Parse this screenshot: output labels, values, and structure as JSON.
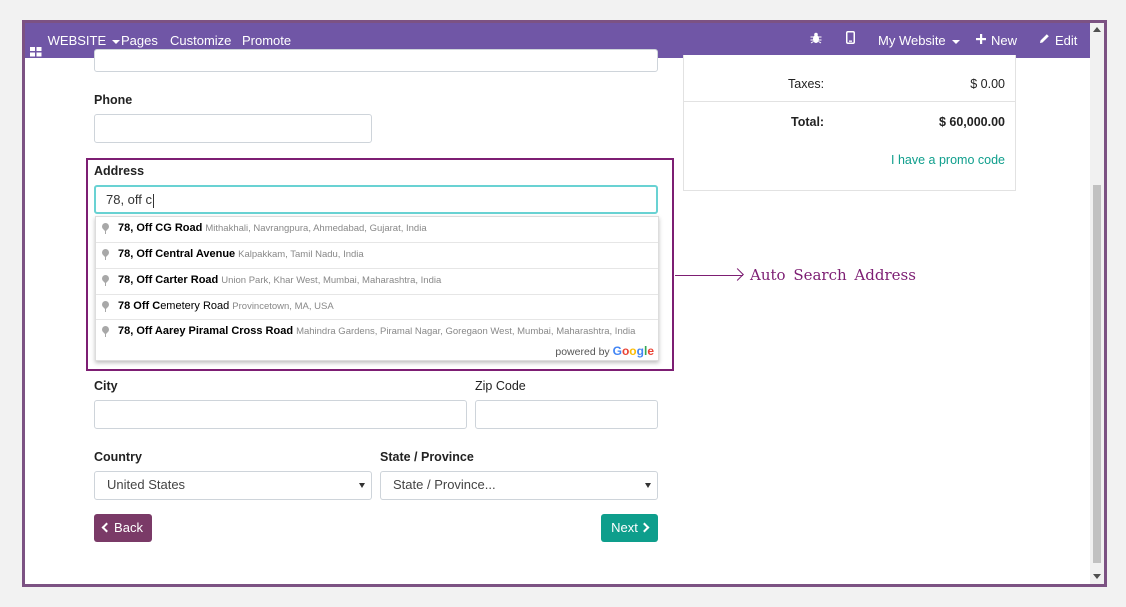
{
  "topbar": {
    "website_label": "WEBSITE",
    "nav": [
      "Pages",
      "Customize",
      "Promote"
    ],
    "my_website_label": "My Website",
    "new_label": "New",
    "edit_label": "Edit"
  },
  "form": {
    "phone_label": "Phone",
    "phone_value": "",
    "address_label": "Address",
    "address_value": "78, off c",
    "city_label": "City",
    "zip_label": "Zip Code",
    "country_label": "Country",
    "country_value": "United States",
    "state_label": "State / Province",
    "state_value": "State / Province..."
  },
  "suggestions": [
    {
      "bold": "78, Off CG Road",
      "normal": "",
      "secondary": "Mithakhali, Navrangpura, Ahmedabad, Gujarat, India"
    },
    {
      "bold": "78, Off Central Avenue",
      "normal": "",
      "secondary": "Kalpakkam, Tamil Nadu, India"
    },
    {
      "bold": "78, Off Carter Road",
      "normal": "",
      "secondary": "Union Park, Khar West, Mumbai, Maharashtra, India"
    },
    {
      "bold": "78 Off C",
      "normal": "emetery Road",
      "secondary": "Provincetown, MA, USA"
    },
    {
      "bold": "78, Off Aarey Piramal Cross Road",
      "normal": "",
      "secondary": "Mahindra Gardens, Piramal Nagar, Goregaon West, Mumbai, Maharashtra, India"
    }
  ],
  "powered_by": {
    "prefix": "powered by",
    "brand": "Google"
  },
  "callout": "Auto Search Address",
  "summary": {
    "taxes_label": "Taxes:",
    "taxes_value": "$ 0.00",
    "total_label": "Total:",
    "total_value": "$ 60,000.00",
    "promo_link": "I have a promo code"
  },
  "buttons": {
    "back": "Back",
    "next": "Next"
  },
  "colors": {
    "topbar": "#7056a6",
    "highlight_border": "#7d1e73",
    "back_button": "#7a3a67",
    "next_button": "#0e9e8c",
    "promo_link": "#0e9e8c",
    "input_focus": "#69d2d3"
  },
  "icons": {
    "apps": "grid-icon",
    "debug": "bug-icon",
    "mobile": "mobile-icon",
    "new": "plus-icon",
    "edit": "pencil-icon",
    "suggestion": "map-pin-icon"
  }
}
